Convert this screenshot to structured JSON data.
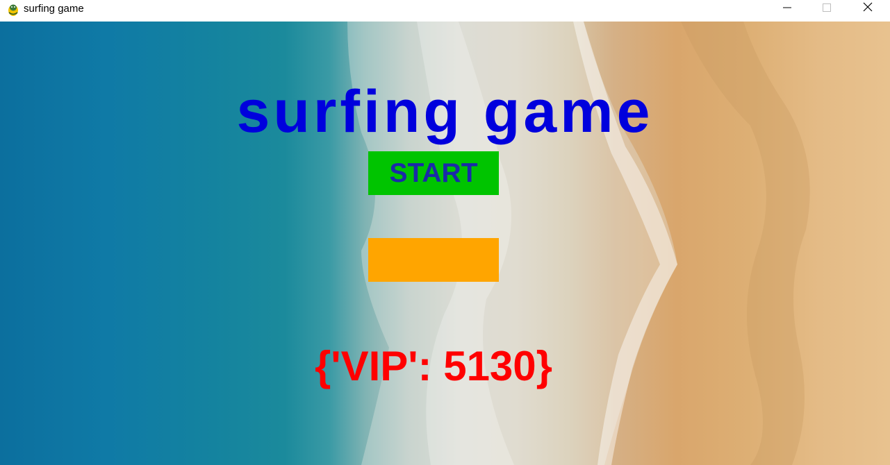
{
  "window": {
    "title": "surfing game",
    "app_icon": "python-snake-icon",
    "controls": {
      "minimize_icon": "minimize-icon",
      "maximize_icon": "maximize-icon",
      "close_icon": "close-icon"
    }
  },
  "game": {
    "title": "surfing game",
    "start_label": "START",
    "second_button_label": "",
    "score_text": "{'VIP': 5130}"
  },
  "colors": {
    "title_text": "#0000dd",
    "start_button_bg": "#00c400",
    "start_button_text": "#1a2aa8",
    "second_button_bg": "#ffa500",
    "score_text": "#ff0000"
  }
}
